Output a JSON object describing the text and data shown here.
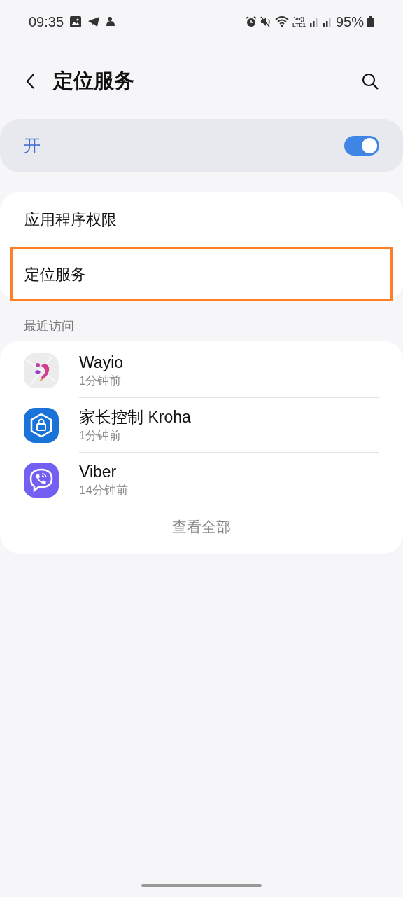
{
  "status_bar": {
    "time": "09:35",
    "volte": "Vo))",
    "network": "LTE1",
    "battery": "95%"
  },
  "header": {
    "title": "定位服务"
  },
  "master_switch": {
    "label": "开",
    "on": true
  },
  "menu": [
    {
      "label": "应用程序权限",
      "highlighted": false
    },
    {
      "label": "定位服务",
      "highlighted": true
    }
  ],
  "recent": {
    "title": "最近访问",
    "apps": [
      {
        "name": "Wayio",
        "time": "1分钟前"
      },
      {
        "name": "家长控制 Kroha",
        "time": "1分钟前"
      },
      {
        "name": "Viber",
        "time": "14分钟前"
      }
    ],
    "view_all": "查看全部"
  }
}
